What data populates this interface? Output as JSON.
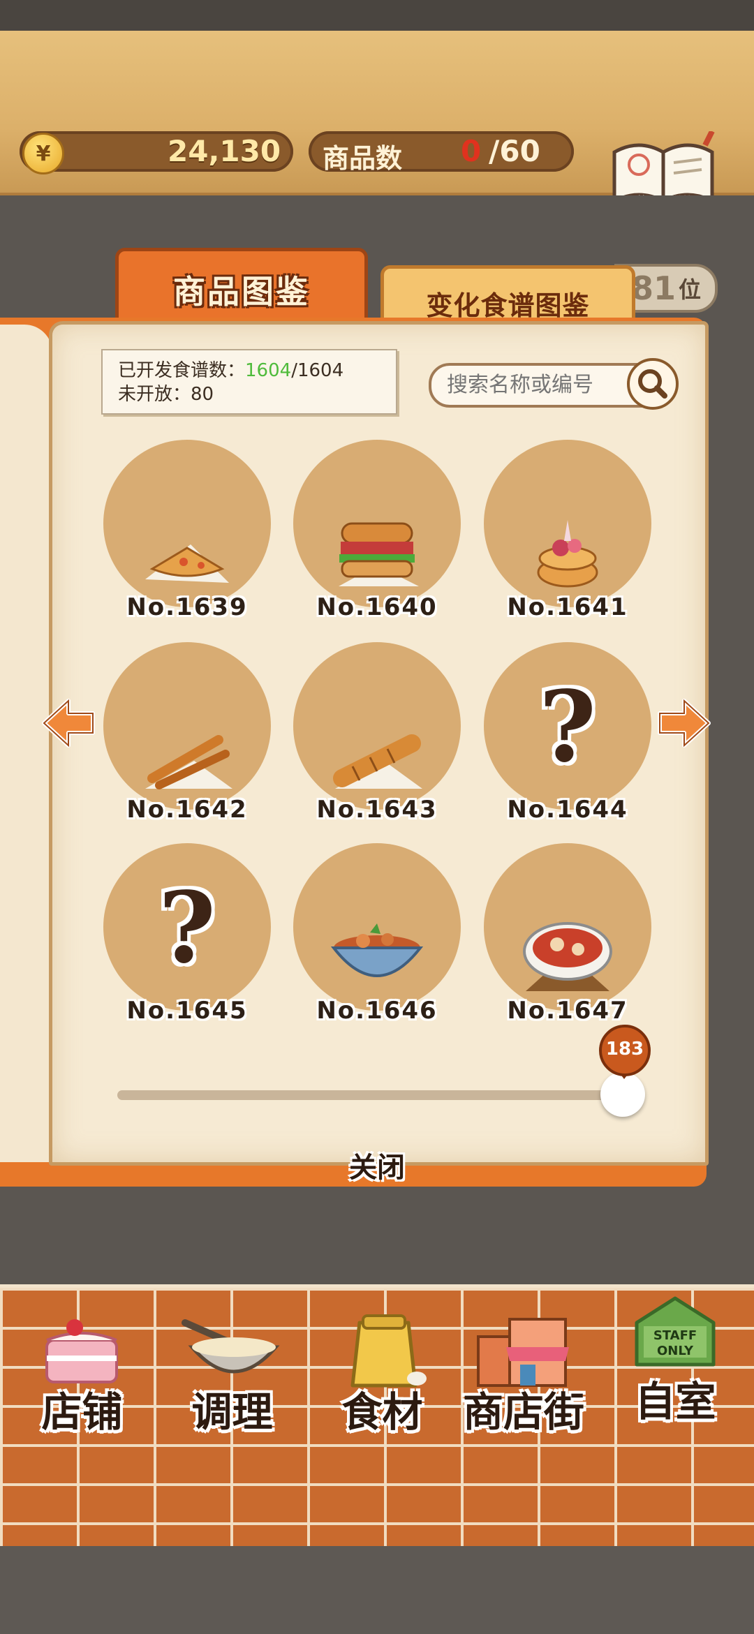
{
  "header": {
    "gold": "24,130",
    "products_label": "商品数",
    "products_current": "0",
    "products_total": "/60",
    "recipe_book_label": "食谱"
  },
  "tabs": [
    {
      "label": "商品图鉴",
      "active": true
    },
    {
      "label": "变化食谱图鉴",
      "active": false
    }
  ],
  "rank": {
    "value": "81",
    "unit": "位"
  },
  "info": {
    "developed_label": "已开发食谱数：",
    "developed_count": "1604",
    "developed_total": "/1604",
    "unopened_label": "未开放：",
    "unopened_count": "80"
  },
  "search": {
    "placeholder": "搜索名称或编号"
  },
  "items": [
    {
      "number": "No.1639",
      "icon": "calzone-icon",
      "unknown": false
    },
    {
      "number": "No.1640",
      "icon": "sandwich-icon",
      "unknown": false
    },
    {
      "number": "No.1641",
      "icon": "tart-icon",
      "unknown": false
    },
    {
      "number": "No.1642",
      "icon": "breadsticks-icon",
      "unknown": false
    },
    {
      "number": "No.1643",
      "icon": "twist-bread-icon",
      "unknown": false
    },
    {
      "number": "No.1644",
      "icon": "question-mark-icon",
      "unknown": true,
      "symbol": "?"
    },
    {
      "number": "No.1645",
      "icon": "question-mark-icon",
      "unknown": true,
      "symbol": "?"
    },
    {
      "number": "No.1646",
      "icon": "noodle-bowl-icon",
      "unknown": false
    },
    {
      "number": "No.1647",
      "icon": "stew-pot-icon",
      "unknown": false
    }
  ],
  "slider": {
    "value": "183"
  },
  "close_label": "关闭",
  "nav": [
    {
      "label": "店铺",
      "icon": "cake-icon"
    },
    {
      "label": "调理",
      "icon": "mixing-bowl-icon"
    },
    {
      "label": "食材",
      "icon": "flour-sack-icon"
    },
    {
      "label": "商店街",
      "icon": "shop-icon"
    },
    {
      "label": "自室",
      "icon": "staff-only-door-icon",
      "sign": "STAFF ONLY"
    }
  ]
}
